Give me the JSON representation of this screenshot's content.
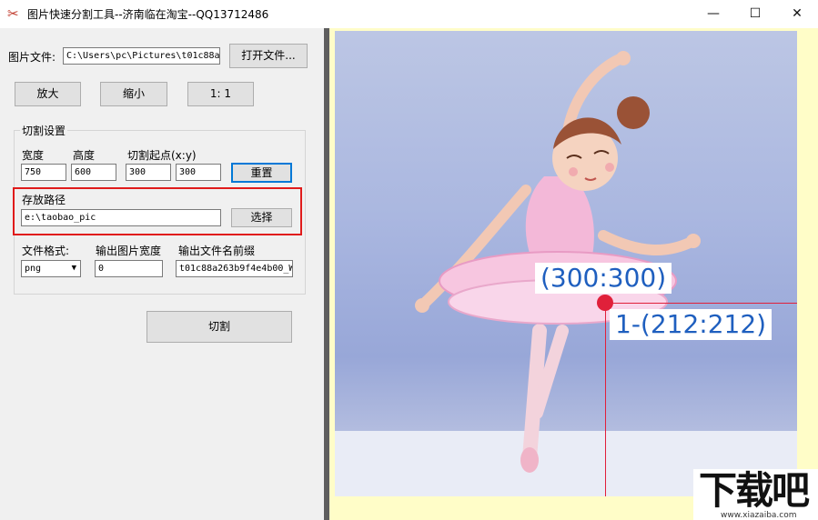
{
  "window": {
    "title": "图片快速分割工具--济南临在淘宝--QQ13712486",
    "minimize": "—",
    "maximize": "☐",
    "close": "✕"
  },
  "file": {
    "label": "图片文件:",
    "path": "C:\\Users\\pc\\Pictures\\t01c88a",
    "open_button": "打开文件..."
  },
  "zoom": {
    "zoom_in": "放大",
    "zoom_out": "缩小",
    "ratio": "1: 1"
  },
  "cut_settings": {
    "group_label": "切割设置",
    "width_label": "宽度",
    "height_label": "高度",
    "origin_label": "切割起点(x:y)",
    "width": "750",
    "height": "600",
    "origin_x": "300",
    "origin_y": "300",
    "reset_button": "重置",
    "save_path_label": "存放路径",
    "save_path": "e:\\taobao_pic",
    "browse_button": "选择",
    "format_label": "文件格式:",
    "format": "png",
    "output_width_label": "输出图片宽度",
    "output_width": "0",
    "prefix_label": "输出文件名前缀",
    "prefix": "t01c88a263b9f4e4b00_W"
  },
  "cut_button": "切割",
  "preview": {
    "origin_label": "(300:300)",
    "piece_label": "1-(212:212)"
  },
  "watermark": {
    "main": "下载吧",
    "sub": "www.xiazaiba.com"
  }
}
